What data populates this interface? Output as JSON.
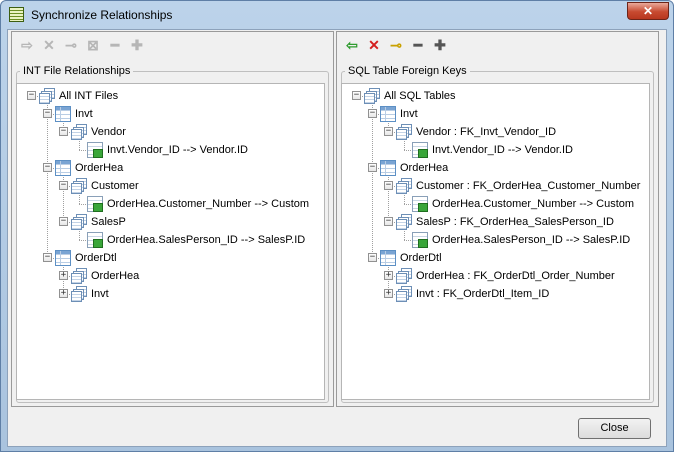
{
  "window": {
    "title": "Synchronize Relationships",
    "close_glyph": "✕"
  },
  "left": {
    "group_label": "INT File Relationships",
    "toolbar": [
      {
        "icon": "arrow-right-icon",
        "glyph": "⇨",
        "enabled": false
      },
      {
        "icon": "delete-x-icon",
        "glyph": "✕",
        "enabled": false
      },
      {
        "icon": "key-icon",
        "glyph": "⊸",
        "enabled": false
      },
      {
        "icon": "key-delete-icon",
        "glyph": "⊠",
        "enabled": false
      },
      {
        "icon": "minus-icon",
        "glyph": "━",
        "enabled": false
      },
      {
        "icon": "plus-icon",
        "glyph": "✚",
        "enabled": false
      }
    ],
    "nodes": [
      {
        "label": "All INT Files",
        "level": 0,
        "exp": "−",
        "icon": "stack",
        "bold": false
      },
      {
        "label": "Invt",
        "level": 1,
        "exp": "−",
        "icon": "table"
      },
      {
        "label": "Vendor",
        "level": 2,
        "exp": "−",
        "icon": "stack"
      },
      {
        "label": "Invt.Vendor_ID --> Vendor.ID",
        "level": 3,
        "exp": "",
        "icon": "link"
      },
      {
        "label": "OrderHea",
        "level": 1,
        "exp": "−",
        "icon": "table"
      },
      {
        "label": "Customer",
        "level": 2,
        "exp": "−",
        "icon": "stack"
      },
      {
        "label": "OrderHea.Customer_Number --> Custom",
        "level": 3,
        "exp": "",
        "icon": "link"
      },
      {
        "label": "SalesP",
        "level": 2,
        "exp": "−",
        "icon": "stack"
      },
      {
        "label": "OrderHea.SalesPerson_ID --> SalesP.ID",
        "level": 3,
        "exp": "",
        "icon": "link"
      },
      {
        "label": "OrderDtl",
        "level": 1,
        "exp": "−",
        "icon": "table"
      },
      {
        "label": "OrderHea",
        "level": 2,
        "exp": "+",
        "icon": "stack"
      },
      {
        "label": "Invt",
        "level": 2,
        "exp": "+",
        "icon": "stack"
      }
    ]
  },
  "right": {
    "group_label": "SQL Table Foreign Keys",
    "toolbar": [
      {
        "icon": "arrow-left-icon",
        "glyph": "⇦",
        "enabled": true,
        "color": "#2e9b2e"
      },
      {
        "icon": "delete-x-icon",
        "glyph": "✕",
        "enabled": true,
        "color": "#d41f1f"
      },
      {
        "icon": "key-icon",
        "glyph": "⊸",
        "enabled": true,
        "color": "#c9a100"
      },
      {
        "icon": "minus-icon",
        "glyph": "━",
        "enabled": true,
        "color": "#555555"
      },
      {
        "icon": "plus-icon",
        "glyph": "✚",
        "enabled": true,
        "color": "#555555"
      }
    ],
    "nodes": [
      {
        "label": "All SQL Tables",
        "level": 0,
        "exp": "−",
        "icon": "stack"
      },
      {
        "label": "Invt",
        "level": 1,
        "exp": "−",
        "icon": "table"
      },
      {
        "label": "Vendor : FK_Invt_Vendor_ID",
        "level": 2,
        "exp": "−",
        "icon": "stack"
      },
      {
        "label": "Invt.Vendor_ID --> Vendor.ID",
        "level": 3,
        "exp": "",
        "icon": "link"
      },
      {
        "label": "OrderHea",
        "level": 1,
        "exp": "−",
        "icon": "table"
      },
      {
        "label": "Customer : FK_OrderHea_Customer_Number",
        "level": 2,
        "exp": "−",
        "icon": "stack"
      },
      {
        "label": "OrderHea.Customer_Number --> Custom",
        "level": 3,
        "exp": "",
        "icon": "link"
      },
      {
        "label": "SalesP : FK_OrderHea_SalesPerson_ID",
        "level": 2,
        "exp": "−",
        "icon": "stack"
      },
      {
        "label": "OrderHea.SalesPerson_ID --> SalesP.ID",
        "level": 3,
        "exp": "",
        "icon": "link"
      },
      {
        "label": "OrderDtl",
        "level": 1,
        "exp": "−",
        "icon": "table"
      },
      {
        "label": "OrderHea : FK_OrderDtl_Order_Number",
        "level": 2,
        "exp": "+",
        "icon": "stack"
      },
      {
        "label": "Invt : FK_OrderDtl_Item_ID",
        "level": 2,
        "exp": "+",
        "icon": "stack"
      }
    ]
  },
  "footer": {
    "close_label": "Close"
  }
}
